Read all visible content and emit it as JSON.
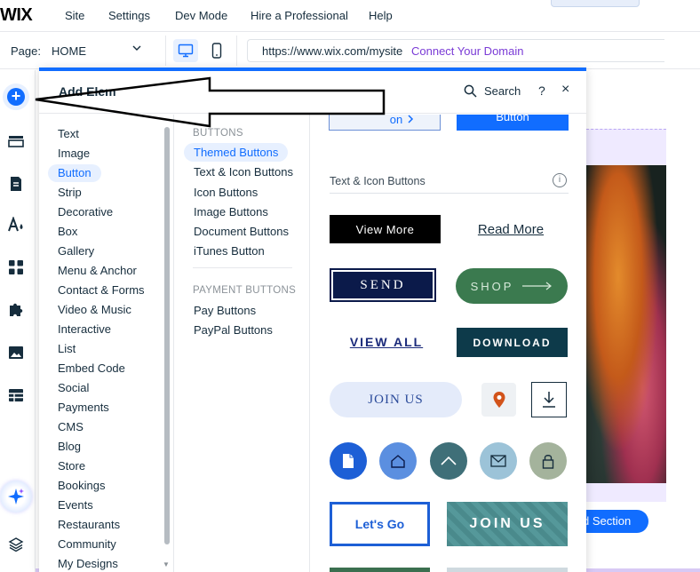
{
  "topbar": {
    "logo": "WIX",
    "menu": [
      "Site",
      "Settings",
      "Dev Mode",
      "Hire a Professional",
      "Help"
    ]
  },
  "subbar": {
    "page_label": "Page:",
    "page_value": "HOME",
    "url": "https://www.wix.com/mysite",
    "connect_domain": "Connect Your Domain"
  },
  "rail": {
    "icons": [
      "add-icon",
      "sections-icon",
      "pages-icon",
      "design-icon",
      "apps-icon",
      "puzzle-icon",
      "media-icon",
      "table-icon",
      "ai-sparkle-icon",
      "layers-icon"
    ]
  },
  "panel": {
    "title": "Add Elem",
    "search_label": "Search",
    "help": "?",
    "close": "×",
    "categories": [
      "Text",
      "Image",
      "Button",
      "Strip",
      "Decorative",
      "Box",
      "Gallery",
      "Menu & Anchor",
      "Contact & Forms",
      "Video & Music",
      "Interactive",
      "List",
      "Embed Code",
      "Social",
      "Payments",
      "CMS",
      "Blog",
      "Store",
      "Bookings",
      "Events",
      "Restaurants",
      "Community",
      "My Designs"
    ],
    "active_category": "Button",
    "buttons_heading": "BUTTONS",
    "buttons_items": [
      "Themed Buttons",
      "Text & Icon Buttons",
      "Icon Buttons",
      "Image Buttons",
      "Document Buttons",
      "iTunes Button"
    ],
    "active_sub": "Themed Buttons",
    "payment_heading": "PAYMENT BUTTONS",
    "payment_items": [
      "Pay Buttons",
      "PayPal Buttons"
    ]
  },
  "preview": {
    "top_left_label": "on",
    "top_right_label": "Button",
    "section_title": "Text & Icon Buttons",
    "info": "i",
    "view_more": "View More",
    "read_more": "Read More",
    "send": "SEND",
    "shop": "SHOP",
    "view_all": "VIEW ALL",
    "download": "DOWNLOAD",
    "join_us": "JOIN US",
    "lets_go": "Let's Go",
    "join_us_2": "JOIN US"
  },
  "canvas": {
    "add_section": "d Section"
  },
  "colors": {
    "accent": "#116dff",
    "connect": "#7a3bd6",
    "shop_green": "#3b7a4f",
    "download_teal": "#0d3a4a",
    "send_navy": "#0b1a4a"
  }
}
